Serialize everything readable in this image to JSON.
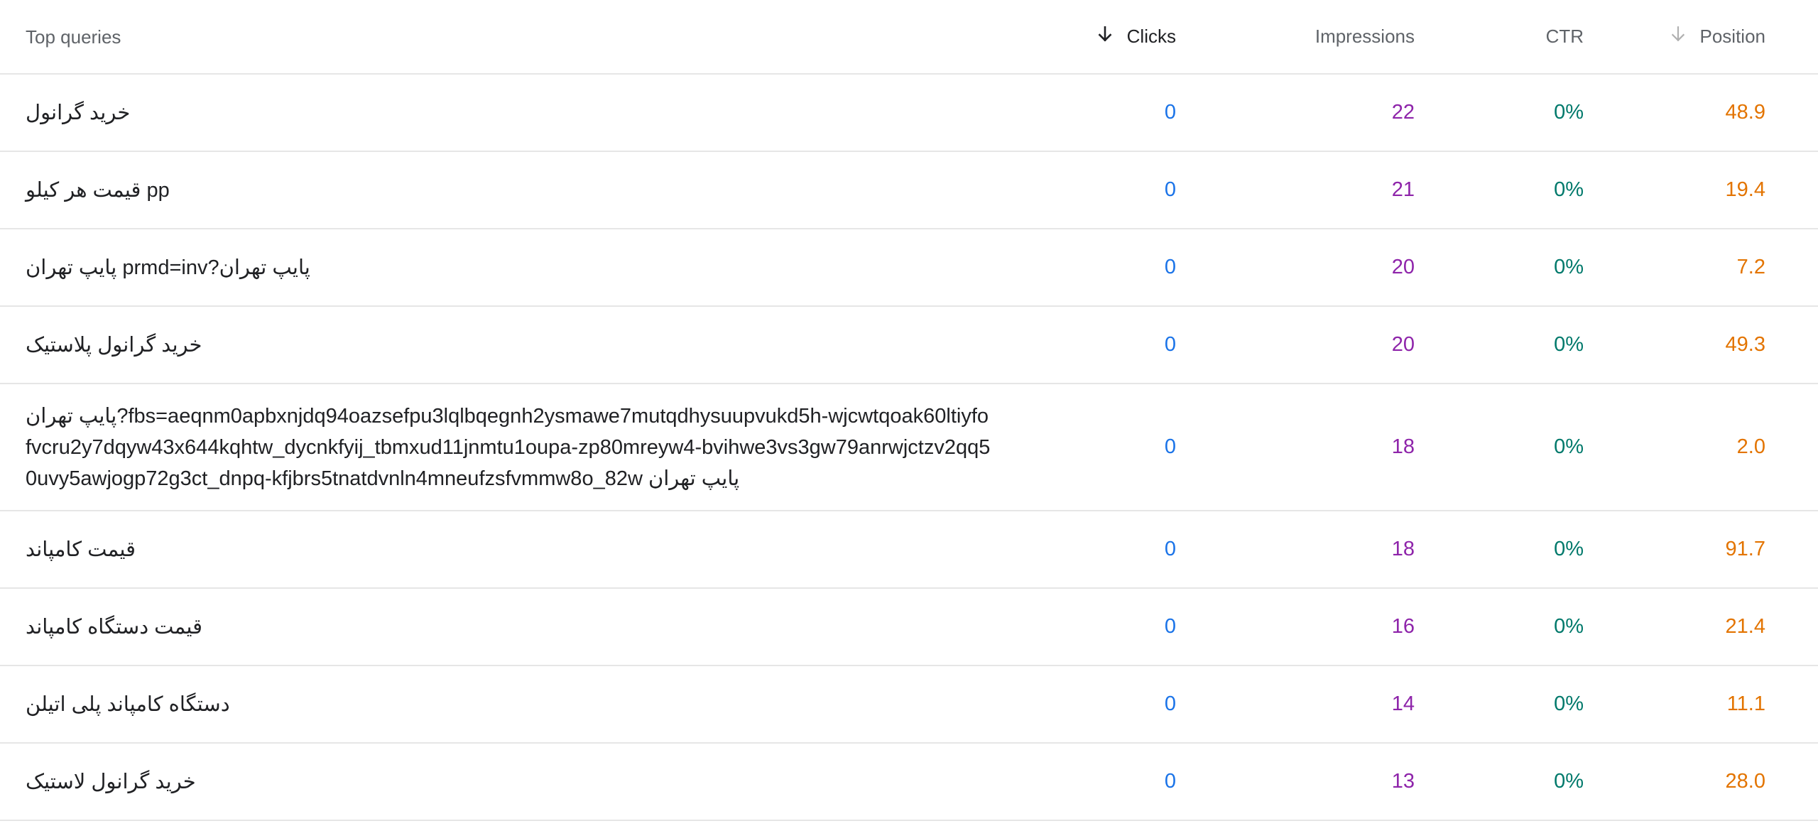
{
  "header": {
    "query": "Top queries",
    "clicks": "Clicks",
    "impressions": "Impressions",
    "ctr": "CTR",
    "position": "Position"
  },
  "colors": {
    "clicks": "#1a73e8",
    "impressions": "#8e24aa",
    "ctr": "#00796b",
    "position": "#e37400",
    "divider": "#e6e6e6"
  },
  "icons": {
    "clicks_sort": "arrow-down-icon",
    "position_sort": "arrow-down-icon"
  },
  "rows": [
    {
      "query": "خرید گرانول",
      "clicks": "0",
      "impressions": "22",
      "ctr": "0%",
      "position": "48.9"
    },
    {
      "query": "قیمت هر کیلو pp",
      "clicks": "0",
      "impressions": "21",
      "ctr": "0%",
      "position": "19.4"
    },
    {
      "query": "پایپ تهران prmd=inv?پایپ تهران",
      "clicks": "0",
      "impressions": "20",
      "ctr": "0%",
      "position": "7.2"
    },
    {
      "query": "خرید گرانول پلاستیک",
      "clicks": "0",
      "impressions": "20",
      "ctr": "0%",
      "position": "49.3"
    },
    {
      "query": "پایپ تهران?fbs=aeqnm0apbxnjdq94oazsefpu3lqlbqegnh2ysmawe7mutqdhysuupvukd5h-wjcwtqoak60ltiyfofvcru2y7dqyw43x644kqhtw_dycnkfyij_tbmxud11jnmtu1oupa-zp80mreyw4-bvihwe3vs3gw79anrwjctzv2qq50uvy5awjogp72g3ct_dnpq-kfjbrs5tnatdvnln4mneufzsfvmmw8o_82w پایپ تهران",
      "clicks": "0",
      "impressions": "18",
      "ctr": "0%",
      "position": "2.0"
    },
    {
      "query": "قیمت کامپاند",
      "clicks": "0",
      "impressions": "18",
      "ctr": "0%",
      "position": "91.7"
    },
    {
      "query": "قیمت دستگاه کامپاند",
      "clicks": "0",
      "impressions": "16",
      "ctr": "0%",
      "position": "21.4"
    },
    {
      "query": "دستگاه کامپاند پلی اتیلن",
      "clicks": "0",
      "impressions": "14",
      "ctr": "0%",
      "position": "11.1"
    },
    {
      "query": "خرید گرانول لاستیک",
      "clicks": "0",
      "impressions": "13",
      "ctr": "0%",
      "position": "28.0"
    }
  ]
}
